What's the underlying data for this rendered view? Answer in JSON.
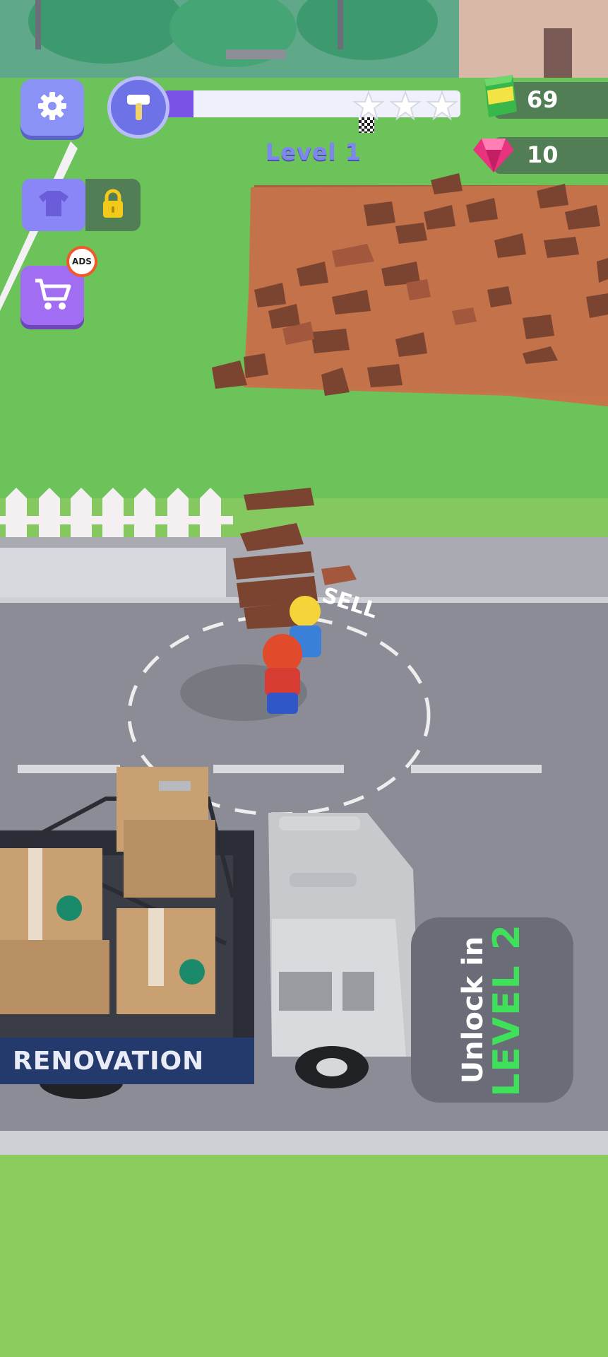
{
  "hud": {
    "level_label": "Level 1",
    "progress": 0.1,
    "stars_total": 3,
    "stars_earned": 0,
    "cash_value": "69",
    "gem_value": "10"
  },
  "side_buttons": {
    "ads_badge": "ADS"
  },
  "world": {
    "road_marking": "SELL",
    "truck_sign": "RENOVATION",
    "unlock_line1": "Unlock in",
    "unlock_line2": "LEVEL 2"
  },
  "colors": {
    "grass": "#8ccb5e",
    "road": "#8b8c95",
    "accent_purple": "#8a93f5",
    "unlock_green": "#3fe05a"
  },
  "icons": [
    "gear-icon",
    "hammer-icon",
    "star-icon",
    "cash-icon",
    "gem-icon",
    "shirt-icon",
    "lock-icon",
    "cart-icon",
    "no-ads-icon"
  ]
}
